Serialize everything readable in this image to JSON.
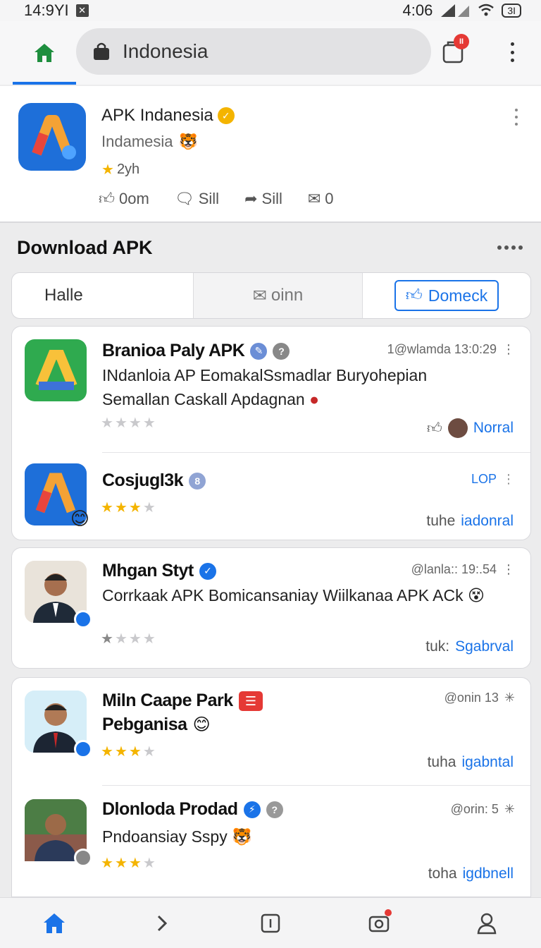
{
  "status_bar": {
    "time": "14:9YI",
    "right_time": "4:06",
    "battery": "3I"
  },
  "search": {
    "text": "Indonesia"
  },
  "top_bar": {
    "tab_count": "II"
  },
  "header": {
    "title": "APK Indanesia",
    "subtitle": "Indamesia",
    "rating": "2yh",
    "likes": "0om",
    "comments": "Sill",
    "shares": "Sill",
    "messages": "0"
  },
  "section": {
    "title": "Download APK"
  },
  "filters": {
    "seg1": "Halle",
    "seg2": "oinn",
    "seg3": "Domeck"
  },
  "items": [
    {
      "title": "Branioa Paly APK",
      "meta": "1@wlamda 13:0:29",
      "text": "INdanloia AP EomakalSsmadlar Buryohepian Semallan Caskall Apdagnan",
      "stars": 0,
      "foot_label": "",
      "foot_link": "Norral"
    },
    {
      "title": "Cosjugl3k",
      "meta": "LOP",
      "text": "",
      "stars": 3,
      "foot_label": "tuhe",
      "foot_link": "iadonral"
    },
    {
      "title": "Mhgan Styt",
      "meta": "@lanla:: 19:.54",
      "text": "Corrkaak APK Bomicansaniay Wiilkanaa APK ACk",
      "stars": 1,
      "foot_label": "tuk:",
      "foot_link": "Sgabrval"
    },
    {
      "title": "Miln Caape Park",
      "meta": "@onin 13",
      "text": "Pebganisa",
      "stars": 3,
      "foot_label": "tuha",
      "foot_link": "igabntal"
    },
    {
      "title": "Dlonloda Prodad",
      "meta": "@orin: 5",
      "text": "Pndoansiay Sspy",
      "stars": 3,
      "foot_label": "toha",
      "foot_link": "igdbnell"
    }
  ],
  "colors": {
    "accent": "#1a73e8",
    "star": "#f4b400",
    "badge": "#e53935",
    "green": "#1e8e3e"
  }
}
